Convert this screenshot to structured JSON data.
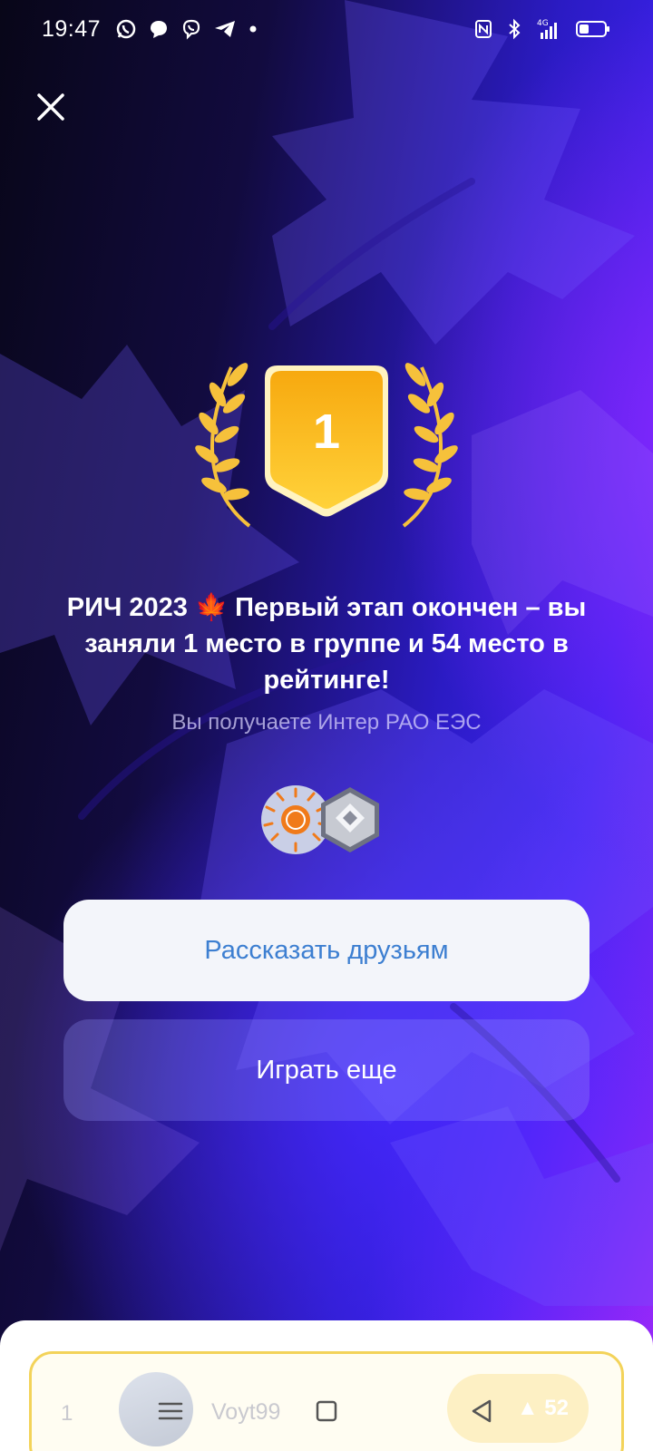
{
  "status_bar": {
    "time": "19:47",
    "app_icons": [
      "whatsapp-icon",
      "chat-bubble-icon",
      "viber-icon",
      "telegram-icon",
      "dot-icon"
    ],
    "system_icons": [
      "nfc-icon",
      "bluetooth-icon",
      "signal-4g-icon",
      "battery-icon"
    ],
    "network_label": "4G"
  },
  "award": {
    "place": "1",
    "badge_color": "#f9b820",
    "laurel_color": "#f6c13b"
  },
  "message": {
    "headline": "РИЧ 2023 🍁 Первый этап окончен – вы заняли 1 место в группе и 54 место в рейтинге!",
    "subline": "Вы получаете Интер РАО ЕЭС"
  },
  "rewards": [
    "inter-rao-logo-icon",
    "silver-rank-badge-icon"
  ],
  "buttons": {
    "share_label": "Рассказать друзьям",
    "play_label": "Играть еще"
  },
  "leaderboard_preview": {
    "rank": "1",
    "name": "Voyt99",
    "score": "▲ 52"
  },
  "nav_bar": {
    "items": [
      "menu-icon",
      "home-square-icon",
      "back-triangle-icon"
    ]
  }
}
